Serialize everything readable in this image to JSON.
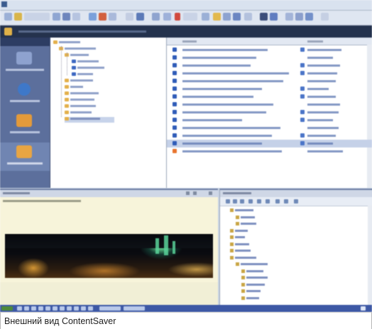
{
  "caption": "Внешний вид ContentSaver",
  "colors": {
    "sidebar": "#5c6f9c",
    "addressbar": "#24324d",
    "selection": "#c5d1e8",
    "preview_bg": "#f7f4da",
    "link_text": "#2d4b8c"
  },
  "icons": [
    "window-icon",
    "toolbar-icon",
    "folder-icon",
    "document-icon",
    "globe-icon",
    "scroll-icon"
  ]
}
